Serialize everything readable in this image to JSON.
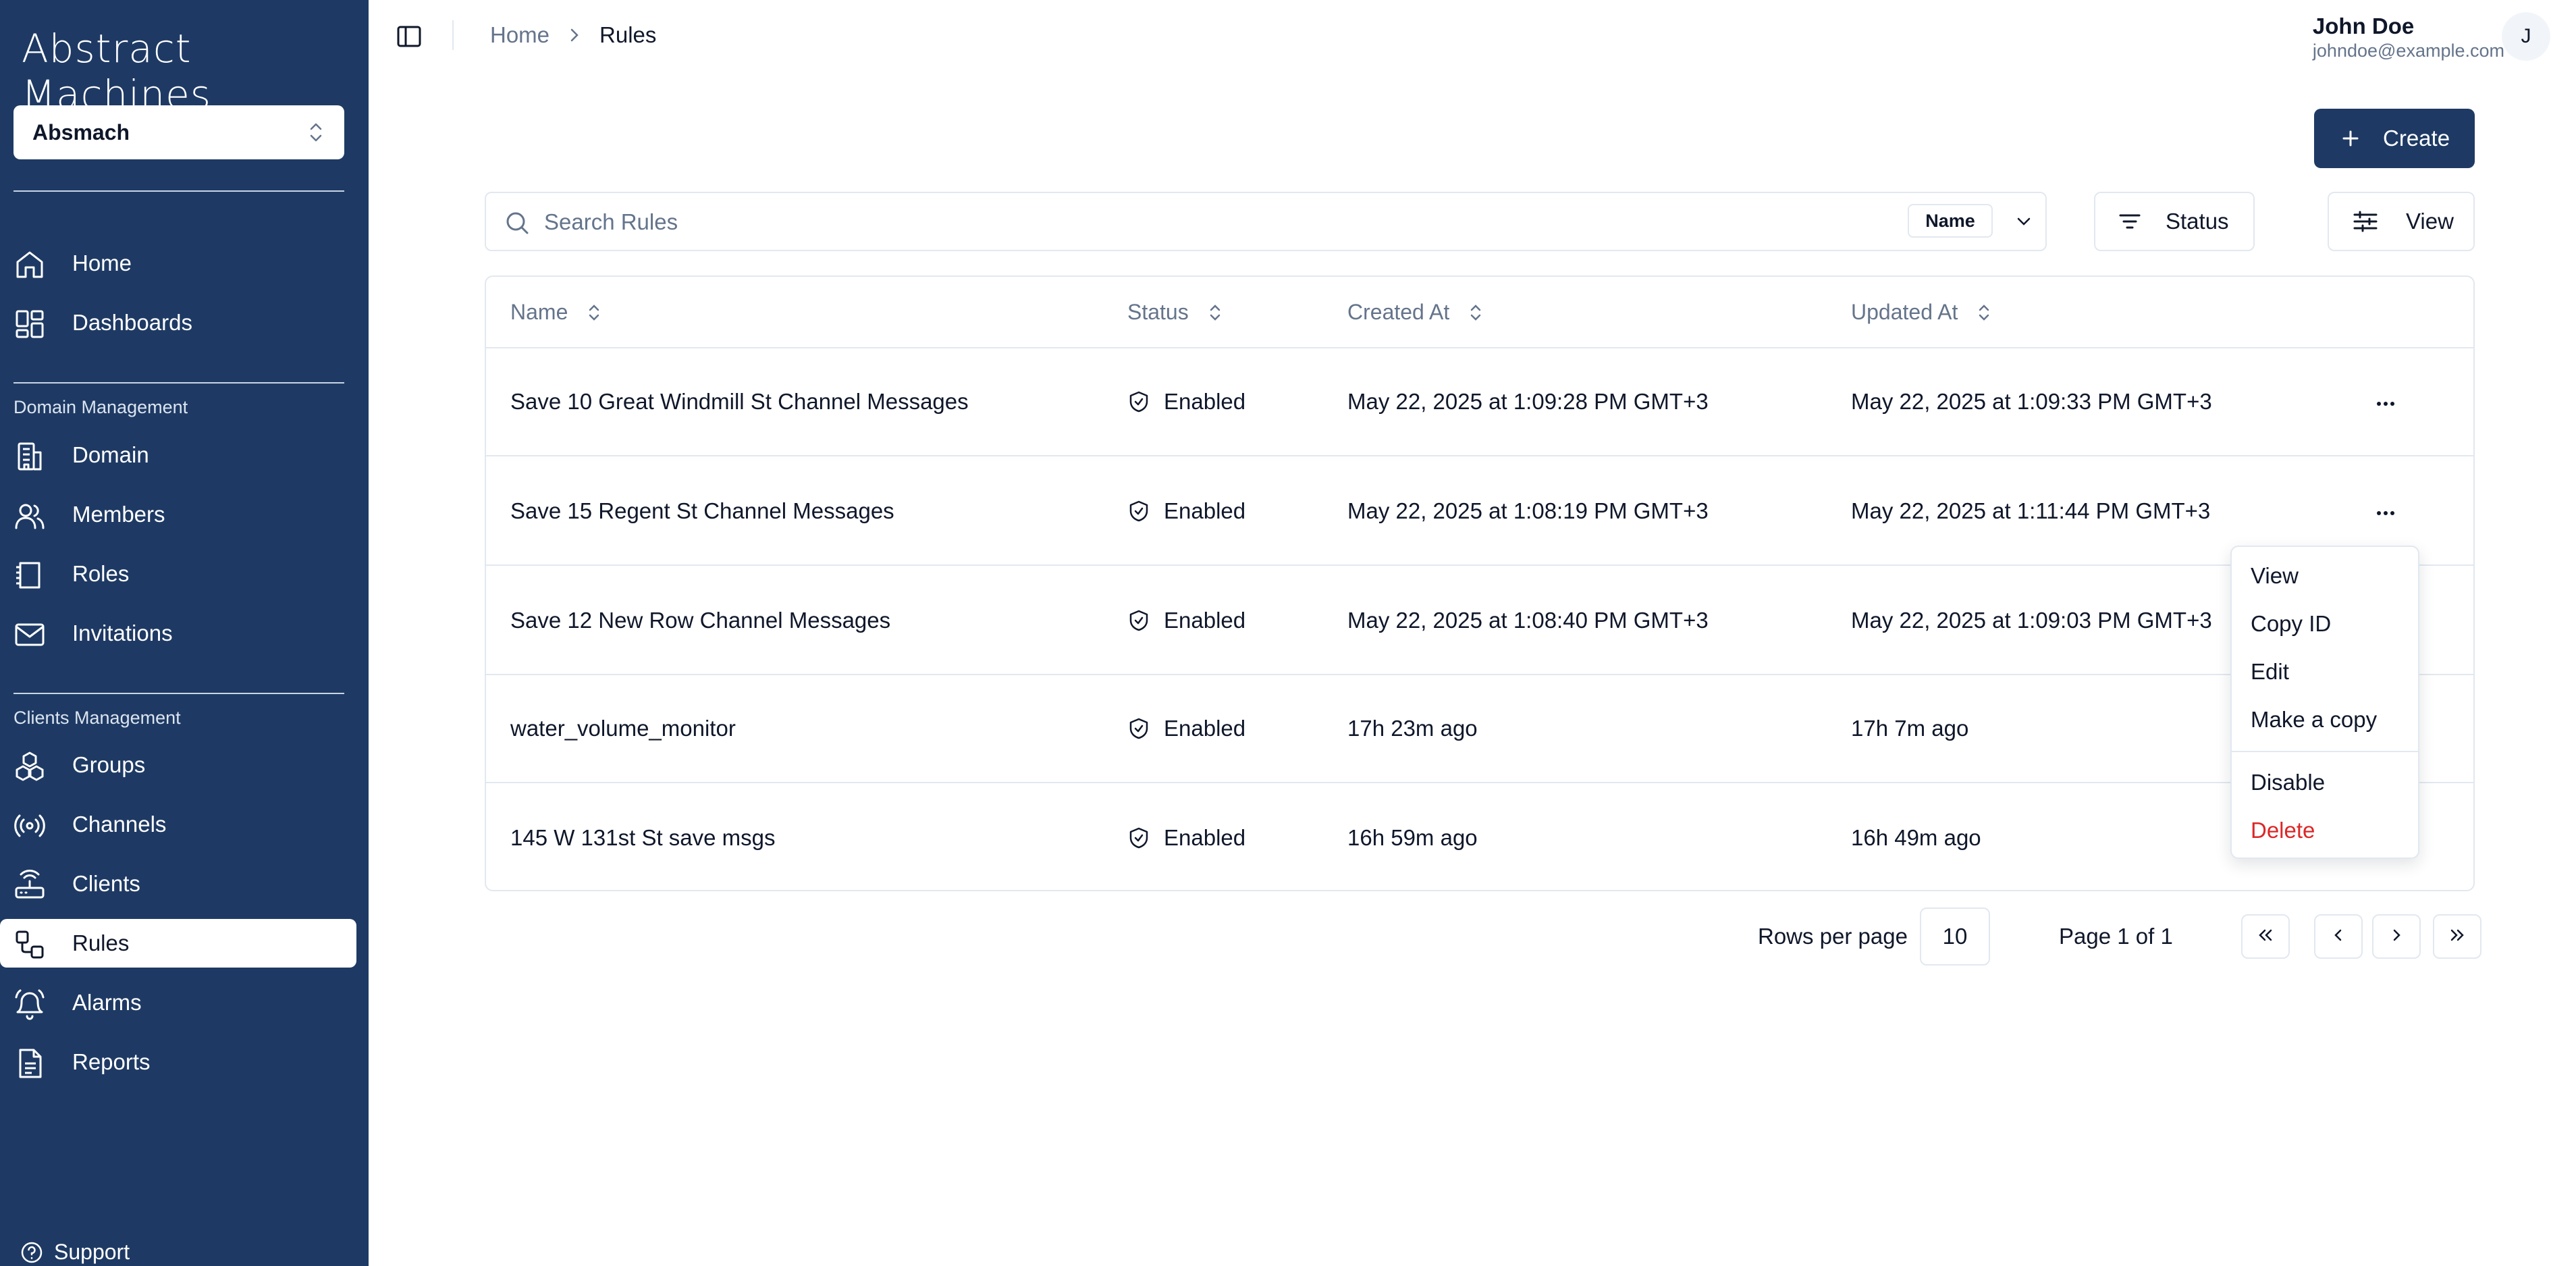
{
  "sidebar": {
    "logo": "Abstract Machines",
    "org": "Absmach",
    "top_items": [
      {
        "label": "Home",
        "icon": "home-icon"
      },
      {
        "label": "Dashboards",
        "icon": "dashboard-icon"
      }
    ],
    "domain_section": "Domain Management",
    "domain_items": [
      {
        "label": "Domain",
        "icon": "building-icon"
      },
      {
        "label": "Members",
        "icon": "users-icon"
      },
      {
        "label": "Roles",
        "icon": "roles-icon"
      },
      {
        "label": "Invitations",
        "icon": "mail-icon"
      }
    ],
    "clients_section": "Clients Management",
    "clients_items": [
      {
        "label": "Groups",
        "icon": "groups-icon"
      },
      {
        "label": "Channels",
        "icon": "radio-icon"
      },
      {
        "label": "Clients",
        "icon": "router-icon"
      },
      {
        "label": "Rules",
        "icon": "workflow-icon"
      },
      {
        "label": "Alarms",
        "icon": "bell-icon"
      },
      {
        "label": "Reports",
        "icon": "file-text-icon"
      }
    ],
    "active_item": "Rules",
    "support": "Support"
  },
  "header": {
    "breadcrumb_home": "Home",
    "breadcrumb_current": "Rules",
    "user_name": "John Doe",
    "user_email": "johndoe@example.com",
    "avatar_initial": "J"
  },
  "toolbar": {
    "create_label": "Create",
    "search_placeholder": "Search Rules",
    "search_field": "Name",
    "status_label": "Status",
    "view_label": "View"
  },
  "table": {
    "columns": [
      "Name",
      "Status",
      "Created At",
      "Updated At"
    ],
    "rows": [
      {
        "name": "Save 10 Great Windmill St Channel Messages",
        "status": "Enabled",
        "created": "May 22, 2025 at 1:09:28 PM GMT+3",
        "updated": "May 22, 2025 at 1:09:33 PM GMT+3"
      },
      {
        "name": "Save 15 Regent St Channel Messages",
        "status": "Enabled",
        "created": "May 22, 2025 at 1:08:19 PM GMT+3",
        "updated": "May 22, 2025 at 1:11:44 PM GMT+3"
      },
      {
        "name": "Save 12 New Row Channel Messages",
        "status": "Enabled",
        "created": "May 22, 2025 at 1:08:40 PM GMT+3",
        "updated": "May 22, 2025 at 1:09:03 PM GMT+3"
      },
      {
        "name": "water_volume_monitor",
        "status": "Enabled",
        "created": "17h 23m ago",
        "updated": "17h 7m ago"
      },
      {
        "name": "145 W 131st St save msgs",
        "status": "Enabled",
        "created": "16h 59m ago",
        "updated": "16h 49m ago"
      }
    ]
  },
  "dropdown": {
    "items": [
      "View",
      "Copy ID",
      "Edit",
      "Make a copy",
      "Disable",
      "Delete"
    ]
  },
  "pagination": {
    "rows_per_page_label": "Rows per page",
    "rows_per_page": "10",
    "page_label": "Page 1 of 1"
  },
  "colors": {
    "sidebar_bg": "#1e3a64",
    "primary": "#1e3a64",
    "danger": "#dc2626",
    "muted_text": "#64748b",
    "border": "#e2e8f0"
  }
}
